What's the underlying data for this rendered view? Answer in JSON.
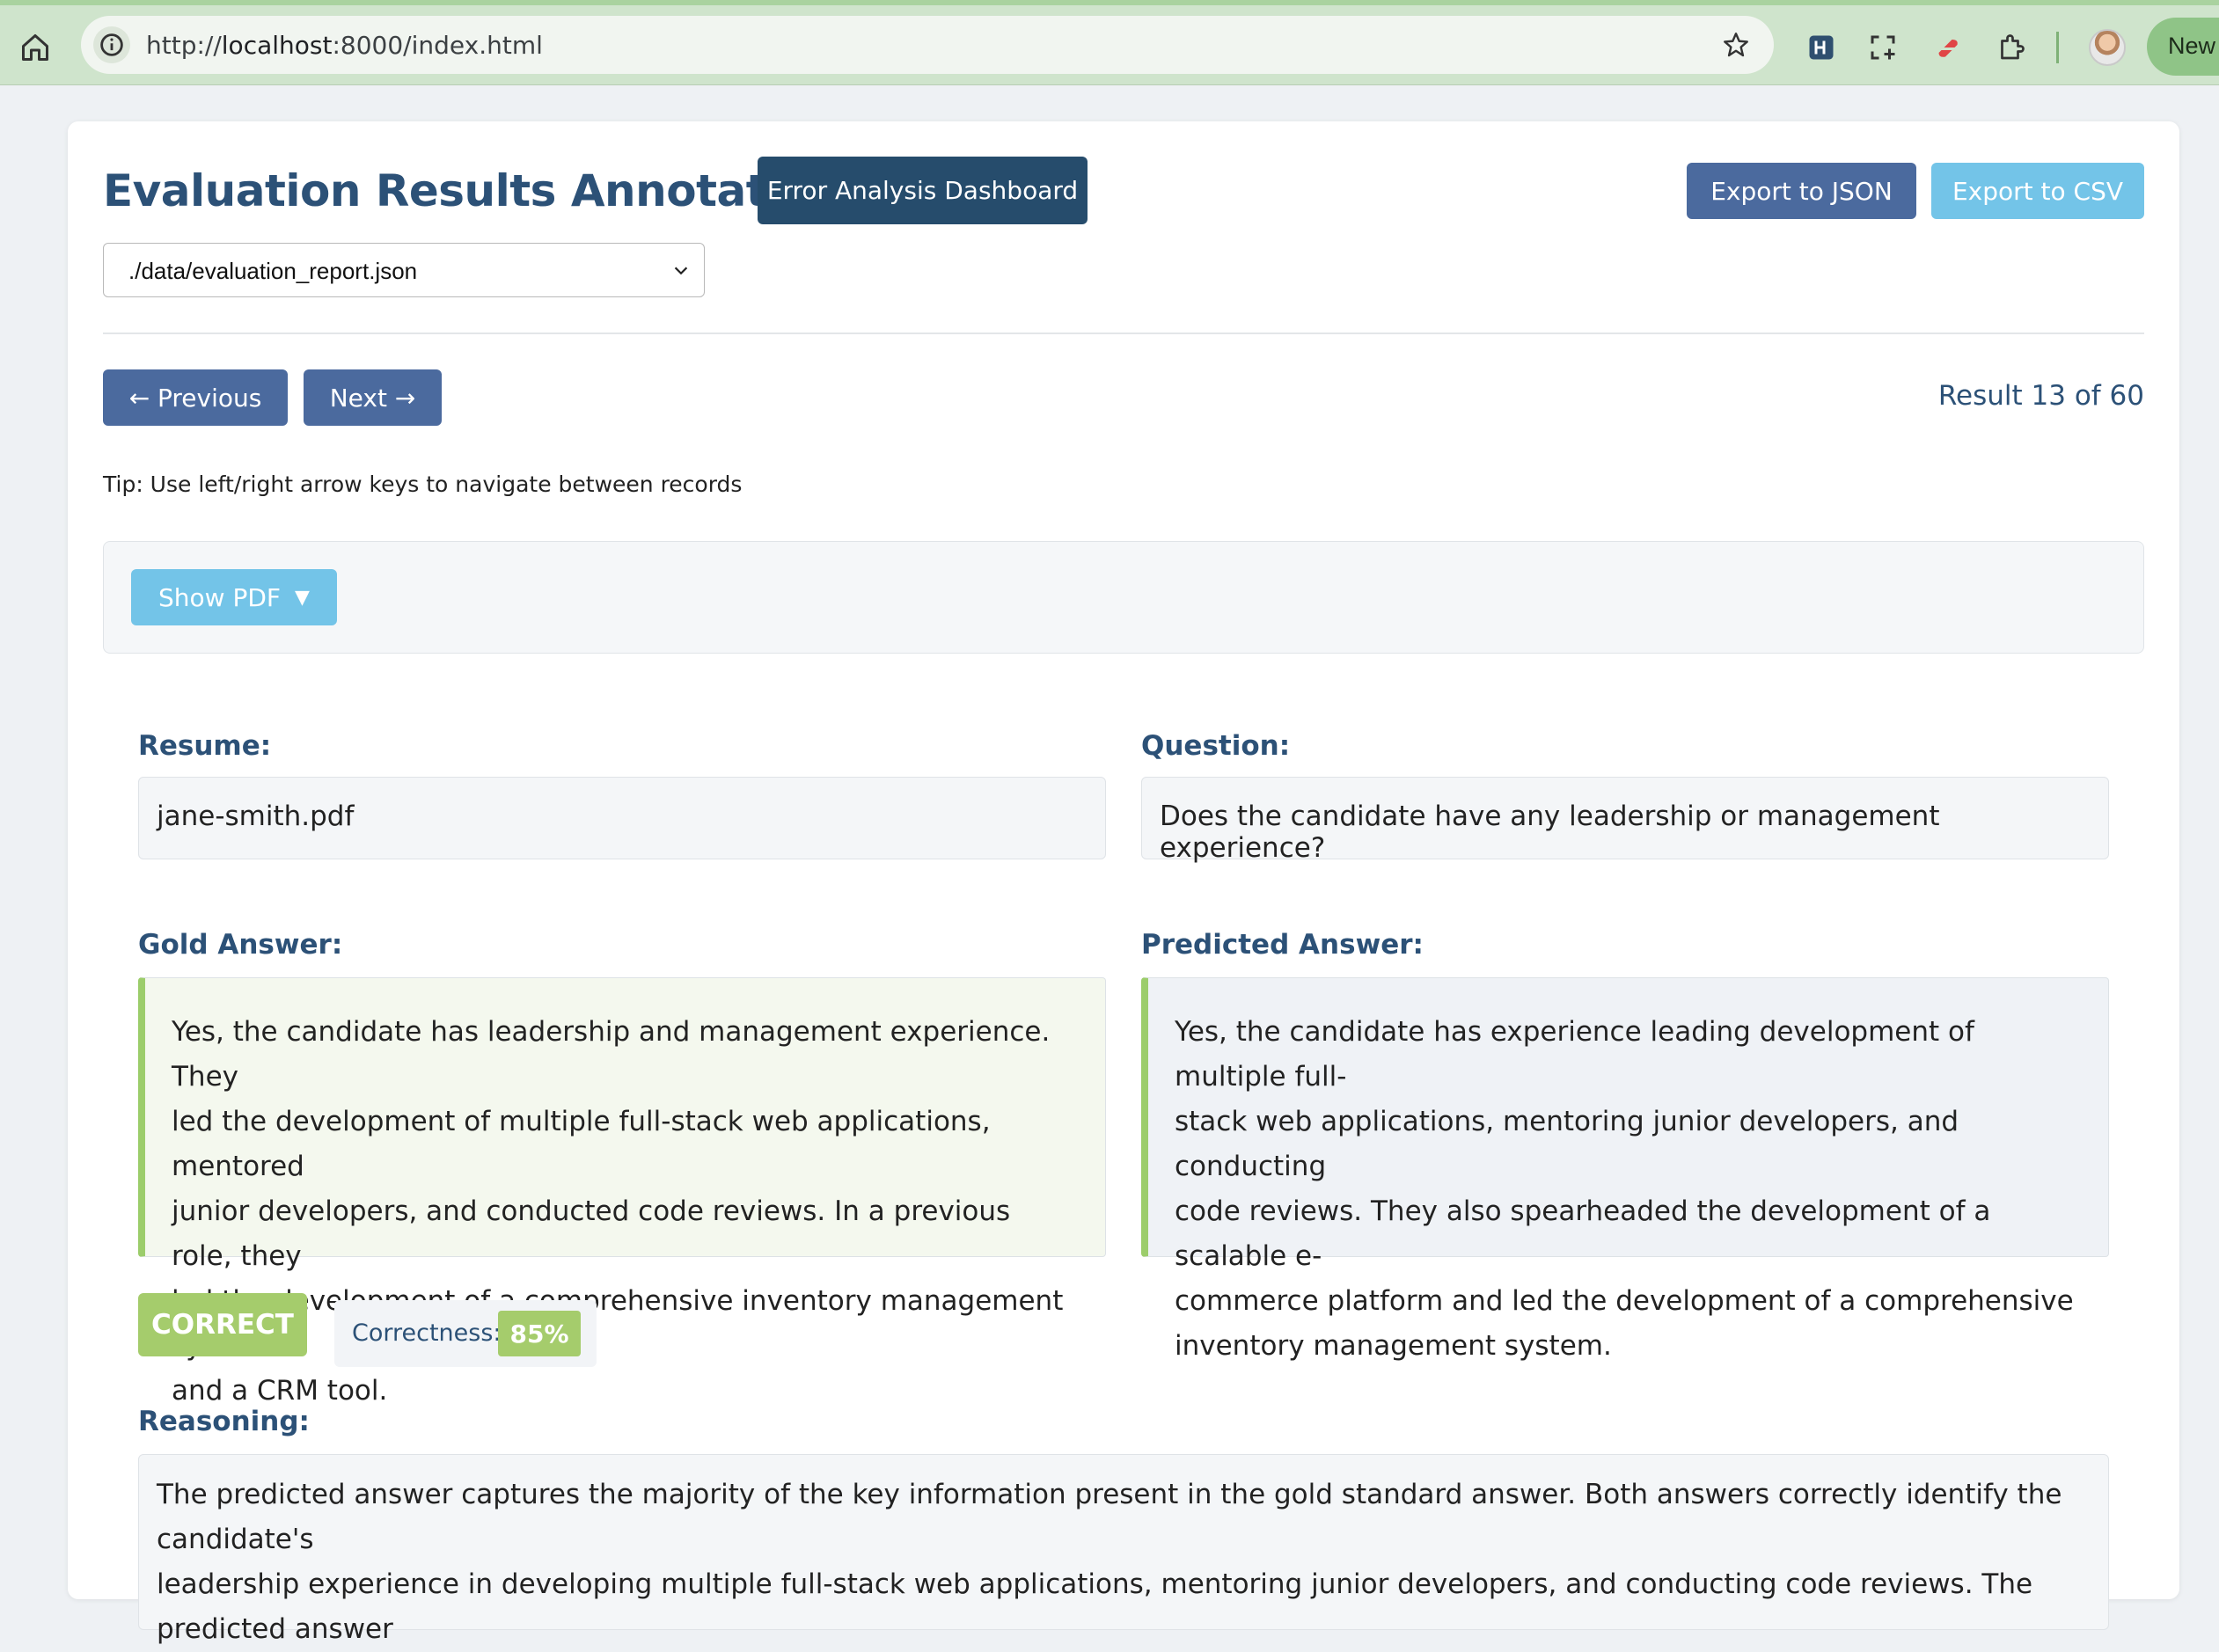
{
  "browser": {
    "url_prefix": "http://",
    "url_host": "localhost",
    "url_rest": ":8000/index.html",
    "new_tab_label": "New"
  },
  "header": {
    "title": "Evaluation Results Annotator",
    "dashboard_button": "Error Analysis Dashboard",
    "export_json_button": "Export to JSON",
    "export_csv_button": "Export to CSV",
    "file_select_value": "./data/evaluation_report.json"
  },
  "nav": {
    "previous_label": "← Previous",
    "next_label": "Next →",
    "result_count": "Result 13 of 60",
    "tip": "Tip: Use left/right arrow keys to navigate between records"
  },
  "pdf": {
    "show_pdf_label": "Show PDF",
    "toggle_icon": "▼"
  },
  "record": {
    "resume_label": "Resume:",
    "resume_value": "jane-smith.pdf",
    "question_label": "Question:",
    "question_value": "Does the candidate have any leadership or management experience?",
    "gold_label": "Gold Answer:",
    "gold_lines": [
      "Yes, the candidate has leadership and management experience. They",
      "led the development of multiple full-stack web applications, mentored",
      "junior developers, and conducted code reviews. In a previous role, they",
      "led the development of a comprehensive inventory management system",
      "and a CRM tool."
    ],
    "predicted_label": "Predicted Answer:",
    "predicted_lines": [
      "Yes, the candidate has experience leading development of multiple full-",
      "stack web applications, mentoring junior developers, and conducting",
      "code reviews. They also spearheaded the development of a scalable e-",
      "commerce platform and led the development of a comprehensive",
      "inventory management system."
    ],
    "verdict": "CORRECT",
    "correctness_label": "Correctness:",
    "correctness_value": "85%",
    "reasoning_label": "Reasoning:",
    "reasoning_lines": [
      "The predicted answer captures the majority of the key information present in the gold standard answer. Both answers correctly identify the candidate's",
      "leadership experience in developing multiple full-stack web applications, mentoring junior developers, and conducting code reviews. The predicted answer"
    ]
  },
  "colors": {
    "primary": "#4b6a9e",
    "dark": "#264c6c",
    "light": "#73c4e8",
    "success": "#a5cc6c",
    "heading": "#2c5177"
  }
}
